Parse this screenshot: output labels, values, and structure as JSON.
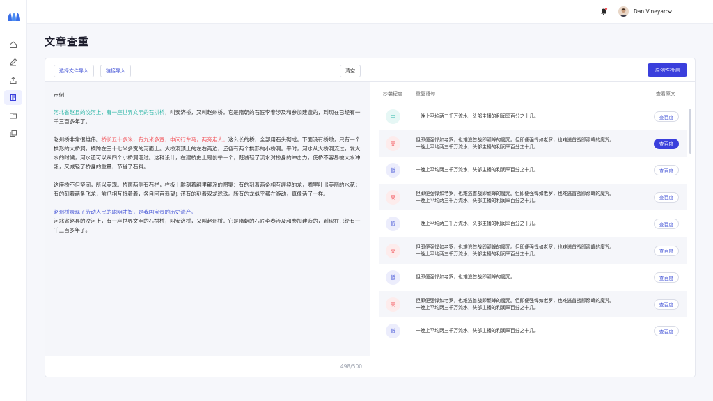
{
  "header": {
    "username": "Dan Vineyard"
  },
  "page": {
    "title": "文章查重"
  },
  "toolbar": {
    "import_file": "选择文件导入",
    "import_link": "链接导入",
    "clear": "清空",
    "originality_check": "原创性检测"
  },
  "editor": {
    "example_label": "示例:",
    "p1": {
      "highlight": "河北省赵县的洨河上，有一座世界文明的石拱桥",
      "rest": "，叫安济桥，又叫赵州桥。它是隋朝的石匠李春涉及和参加建造的，到现在已经有一千三百多年了。"
    },
    "p2": {
      "before": "赵州桥非常很雄伟。",
      "highlight": "桥长五十多米，有九米多宽，中间行车马，两旁走人。",
      "after": "这么长的桥，全部用石头砌成。下面没有桥墩，只有一个拱形的大桥洞，横跨在三十七米多宽的河面上。大桥洞顶上的左右两边，还各有两个拱形的小桥洞。平时，河水从大桥洞流过，发大水的时候，河水还可以从四个小桥洞溜过。这种设计，在建桥史上是创举一个，既减轻了流水对桥身的冲击力，使桥不容易被大水冲毁，又减轻了桥身的重量，节省了石料。"
    },
    "p3": "这座桥不但坚固，所以美观。桥面两侧有石栏，栏板上雕刻着翩里翩涂的图案：有的刻着两条相互缠绕的龙，嘴里吐出美丽的水花；有的刻着两条飞龙，前爪相互抵着着，各自回首遥望；还有的刻着双龙戏珠。所有的龙似乎都在游动，真像活了一样。",
    "p4": {
      "highlight": "赵州桥表现了劳动人民的聪明才智，是我国宝贵的历史遗产。",
      "rest": "河北省赵县的洨河上，有一座世界文明的石拱桥，叫安济桥，又叫赵州桥。它是隋朝的石匠李春涉及和参加建造的，到现在已经有一千三百多年了。"
    },
    "counter": "498/500"
  },
  "results": {
    "columns": {
      "level": "抄袭程度",
      "sentence": "重复语句",
      "source": "查看原文"
    },
    "view_label": "查百度",
    "rows": [
      {
        "level": "中",
        "line1": "一晚上平均两三千万流水，头部主播的利润率百分之十几。",
        "line2": ""
      },
      {
        "level": "高",
        "line1": "但即便强悍如老罗，也难逃首战即巅峰的魔咒。但即便强悍如老罗，也难逃首战即巅峰的魔咒。",
        "line2": "一晚上平均两三千万流水，头部主播的利润率百分之十几。"
      },
      {
        "level": "低",
        "line1": "一晚上平均两三千万流水，头部主播的利润率百分之十几。",
        "line2": ""
      },
      {
        "level": "高",
        "line1": "但即便强悍如老罗，也难逃首战即巅峰的魔咒。但即便强悍如老罗，也难逃首战即巅峰的魔咒。",
        "line2": "一晚上平均两三千万流水，头部主播的利润率百分之十几。"
      },
      {
        "level": "低",
        "line1": "一晚上平均两三千万流水，头部主播的利润率百分之十几。",
        "line2": ""
      },
      {
        "level": "高",
        "line1": "但即便强悍如老罗，也难逃首战即巅峰的魔咒。但即便强悍如老罗，也难逃首战即巅峰的魔咒。",
        "line2": "一晚上平均两三千万流水，头部主播的利润率百分之十几。"
      },
      {
        "level": "低",
        "line1": "但即便强悍如老罗，也难逃首战即巅峰的魔咒。",
        "line2": ""
      },
      {
        "level": "高",
        "line1": "但即便强悍如老罗，也难逃首战即巅峰的魔咒。但即便强悍如老罗，也难逃首战即巅峰的魔咒。",
        "line2": "一晚上平均两三千万流水，头部主播的利润率百分之十几。"
      },
      {
        "level": "低",
        "line1": "一晚上平均两三千万流水，头部主播的利润率百分之十几。",
        "line2": ""
      }
    ]
  },
  "colors": {
    "primary": "#3a3fdc",
    "teal": "#2bb6a6",
    "red": "#f2555b",
    "blue": "#4b5bd8"
  }
}
